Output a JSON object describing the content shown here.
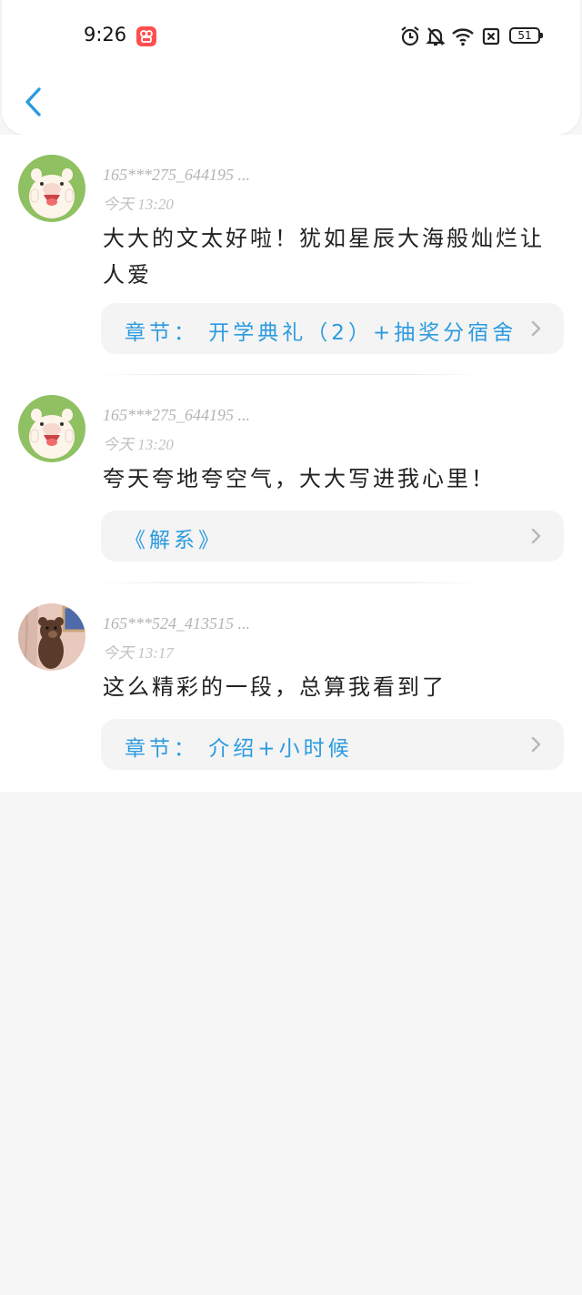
{
  "status_bar": {
    "time": "9:26",
    "battery": "51",
    "icons": [
      "app-notification-icon",
      "alarm-icon",
      "mute-bell-icon",
      "wifi-icon",
      "sim-blocked-icon",
      "battery-icon"
    ]
  },
  "nav": {
    "back_icon": "chevron-left-icon"
  },
  "colors": {
    "accent": "#2b9be0",
    "chapter_bg": "#f4f4f4",
    "page_bg": "#f7f6f7"
  },
  "comments": [
    {
      "username": "165***275_644195 ...",
      "time": "今天 13:20",
      "content": "大大的文太好啦！犹如星辰大海般灿烂让人爱",
      "chapter": "章节： 开学典礼（2）+抽奖分宿舍",
      "avatar": "pig-avatar"
    },
    {
      "username": "165***275_644195 ...",
      "time": "今天 13:20",
      "content": "夸天夸地夸空气，大大写进我心里！",
      "chapter": "《解系》",
      "avatar": "pig-avatar"
    },
    {
      "username": "165***524_413515 ...",
      "time": "今天 13:17",
      "content": "这么精彩的一段，总算我看到了",
      "chapter": "章节： 介绍+小时候",
      "avatar": "bear-avatar"
    }
  ]
}
